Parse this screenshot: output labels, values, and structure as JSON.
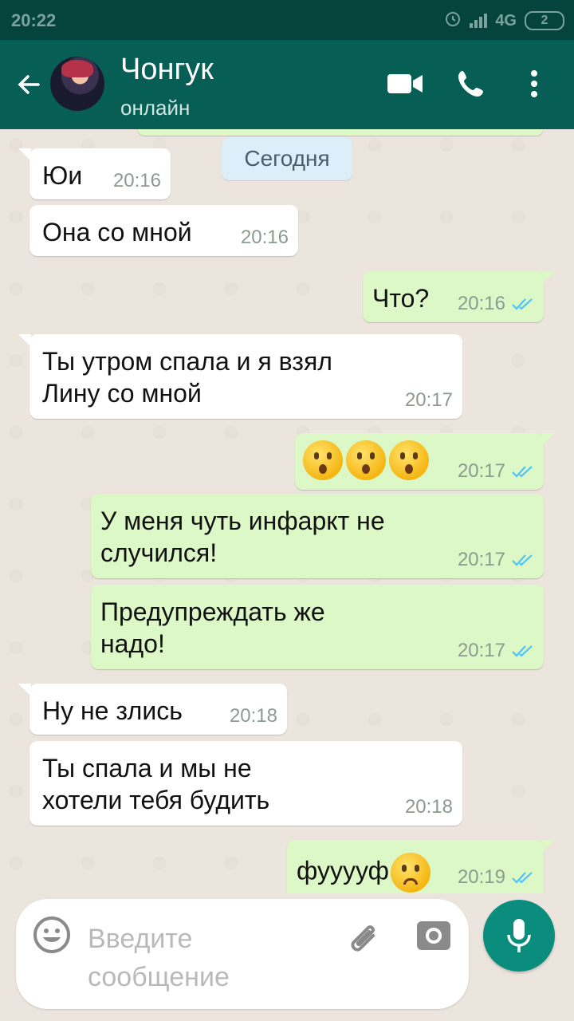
{
  "status_bar": {
    "time": "20:22",
    "network": "4G",
    "battery": "2"
  },
  "header": {
    "contact_name": "Чонгук",
    "presence": "онлайн"
  },
  "chat": {
    "date_chip": "Сегодня",
    "messages": [
      {
        "dir": "in",
        "text": "Юи",
        "time": "20:16"
      },
      {
        "dir": "in",
        "text": "Она со мной",
        "time": "20:16"
      },
      {
        "dir": "out",
        "text": "Что?",
        "time": "20:16"
      },
      {
        "dir": "in",
        "text_lines": [
          "Ты утром спала и я взял",
          "Лину со мной"
        ],
        "time": "20:17"
      },
      {
        "dir": "out",
        "emoji": "hushed-face",
        "emoji_count": 3,
        "time": "20:17"
      },
      {
        "dir": "out",
        "text_lines": [
          "У меня чуть инфаркт не",
          "случился!"
        ],
        "time": "20:17"
      },
      {
        "dir": "out",
        "text_lines": [
          "Предупреждать же",
          "надо!"
        ],
        "time": "20:17"
      },
      {
        "dir": "in",
        "text": "Ну не злись",
        "time": "20:18"
      },
      {
        "dir": "in",
        "text_lines": [
          "Ты спала и мы не",
          "хотели тебя будить"
        ],
        "time": "20:18"
      },
      {
        "dir": "out",
        "text": "фууууф",
        "emoji": "disappointed-face",
        "time": "20:19"
      }
    ]
  },
  "composer": {
    "placeholder": "Введите сообщение"
  },
  "colors": {
    "header": "#075e54",
    "statusbar": "#04443c",
    "out_bubble": "#dcf8c6",
    "in_bubble": "#ffffff",
    "read_ticks": "#4fc3f7",
    "fab": "#0a8d7c"
  }
}
